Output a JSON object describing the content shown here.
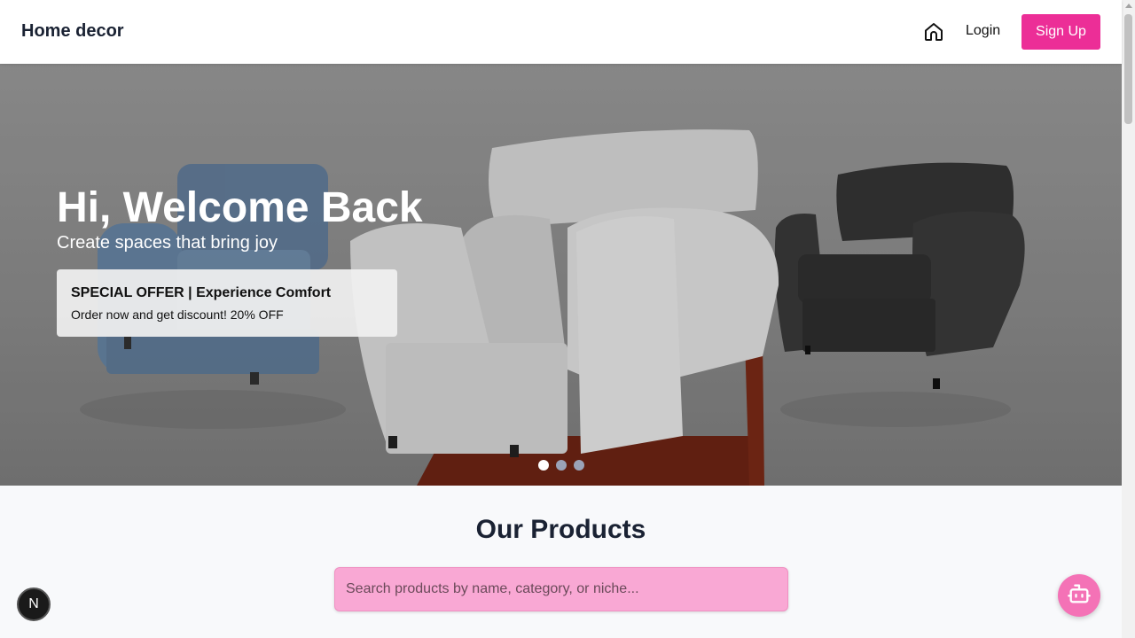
{
  "header": {
    "brand": "Home decor",
    "home_icon": "home-icon",
    "login_label": "Login",
    "signup_label": "Sign Up",
    "accent_color": "#ec2e97"
  },
  "hero": {
    "title": "Hi, Welcome Back",
    "subtitle": "Create spaces that bring joy",
    "offer": {
      "title": "SPECIAL OFFER | Experience Comfort",
      "text": "Order now and get discount! 20% OFF"
    },
    "slides": {
      "count": 3,
      "active": 1
    }
  },
  "products": {
    "title": "Our Products",
    "search_placeholder": "Search products by name, category, or niche..."
  },
  "floating": {
    "next_badge_label": "N",
    "chatbot_icon": "robot-icon"
  }
}
